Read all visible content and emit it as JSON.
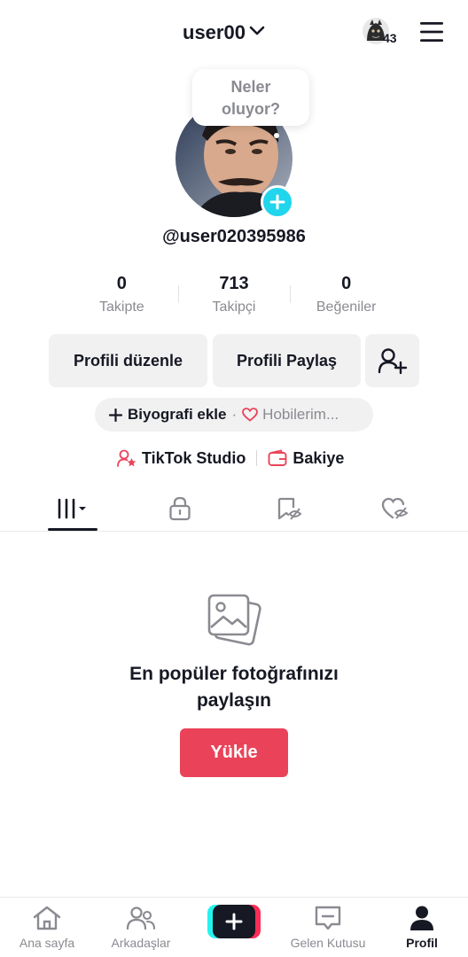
{
  "header": {
    "username": "user00",
    "badge_count": "43"
  },
  "profile": {
    "bubble_text": "Neler oluyor?",
    "handle": "@user020395986"
  },
  "stats": [
    {
      "value": "0",
      "label": "Takipte"
    },
    {
      "value": "713",
      "label": "Takipçi"
    },
    {
      "value": "0",
      "label": "Beğeniler"
    }
  ],
  "actions": {
    "edit_profile": "Profili düzenle",
    "share_profile": "Profili Paylaş"
  },
  "bio": {
    "add_label": "Biyografi ekle",
    "separator": "·",
    "hobbies_label": "Hobilerim..."
  },
  "links": {
    "studio": "TikTok Studio",
    "balance": "Bakiye"
  },
  "empty_state": {
    "line1": "En popüler fotoğrafınızı",
    "line2": "paylaşın",
    "upload_label": "Yükle"
  },
  "bottom_nav": {
    "home": "Ana sayfa",
    "friends": "Arkadaşlar",
    "inbox": "Gelen Kutusu",
    "profile": "Profil"
  },
  "colors": {
    "accent_red": "#ea4359",
    "avatar_add": "#20d5ec",
    "text_primary": "#161823",
    "text_secondary": "#8a8b91"
  }
}
